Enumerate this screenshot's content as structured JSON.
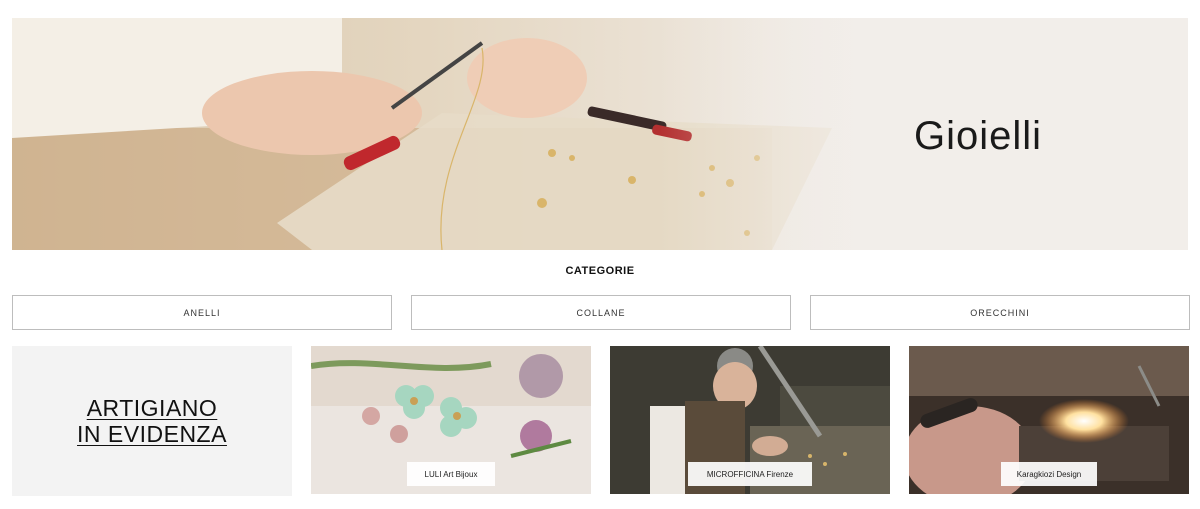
{
  "hero": {
    "title": "Gioielli"
  },
  "categories": {
    "heading": "CATEGORIE",
    "items": [
      {
        "label": "ANELLI"
      },
      {
        "label": "COLLANE"
      },
      {
        "label": "ORECCHINI"
      }
    ]
  },
  "featured": {
    "title_line1": "ARTIGIANO",
    "title_line2": "IN EVIDENZA"
  },
  "artisans": [
    {
      "label": "LULI Art Bijoux"
    },
    {
      "label": "MICROFFICINA Firenze"
    },
    {
      "label": "Karagkiozi Design"
    }
  ]
}
